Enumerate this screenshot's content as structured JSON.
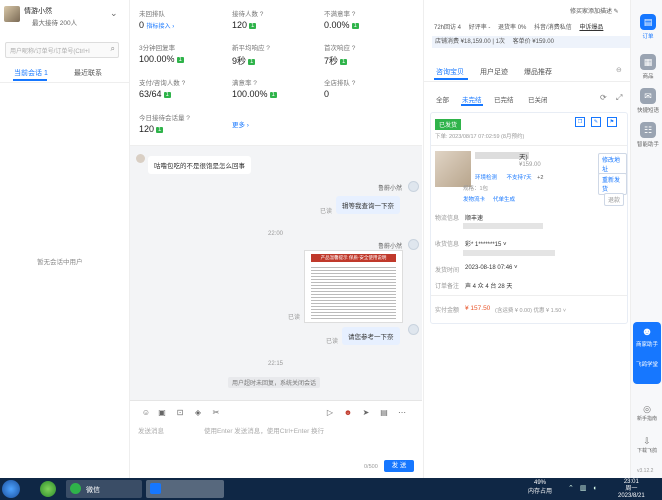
{
  "left": {
    "shop_name": "情游小然",
    "shop_sub": "最大接待 200人",
    "search_placeholder": "用户昵称/订单号/订单号(Ctrl+I",
    "tabs": [
      "当前会话 1",
      "最近联系"
    ],
    "empty_text": "暂无会话中用户"
  },
  "stats": [
    {
      "label": "未回排队",
      "value": "0",
      "extra": "指标接入 ›",
      "badge": ""
    },
    {
      "label": "接待人数 ?",
      "value": "120",
      "extra": "",
      "badge": "1"
    },
    {
      "label": "不满意率 ?",
      "value": "0.00%",
      "extra": "",
      "badge": "1"
    },
    {
      "label": "3分钟回复率",
      "value": "100.00%",
      "extra": "",
      "badge": "1"
    },
    {
      "label": "新平均响应 ?",
      "value": "9秒",
      "extra": "",
      "badge": "1"
    },
    {
      "label": "首次响应 ?",
      "value": "7秒",
      "extra": "",
      "badge": "1"
    },
    {
      "label": "支付/咨询人数 ?",
      "value": "63/64",
      "extra": "",
      "badge": "1"
    },
    {
      "label": "满意率 ?",
      "value": "100.00%",
      "extra": "",
      "badge": "1"
    },
    {
      "label": "全店排队 ?",
      "value": "0",
      "extra": "",
      "badge": ""
    },
    {
      "label": "今日接待会话量 ?",
      "value": "120",
      "extra": "",
      "badge": "1"
    },
    {
      "label": "",
      "value": "",
      "extra": "更多 ›",
      "badge": ""
    }
  ],
  "chat": {
    "m1": "咕噜包吃的不是很饱是怎么回事",
    "agent_name": "鲁蔚小然",
    "read": "已读",
    "m2": "辑等我查询一下奈",
    "time1": "22:00",
    "m3": "请您参考一下奈",
    "time2": "22:15",
    "sys": "用户超时未回复，系统关闭会话",
    "img_title": "产品温馨提示 保质·安全使用说明",
    "input_placeholder": "发送消息",
    "input_hint": "使用Enter 发送消息，使用Ctrl+Enter 换行",
    "send": "发 送",
    "count": "0/500"
  },
  "right": {
    "notice_top": "修买家添加描述 ✎",
    "r72": "72h回访 4",
    "good_rate": "好评率 -",
    "return_rate": "退货率 0%",
    "complaint": "抖音/消费私信",
    "check": "申诉爆品",
    "shop_consumed": "店铺消费 ¥18,159.00 | 1次",
    "single": "客单价 ¥159.00",
    "tabs": [
      "咨询宝贝",
      "用户足迹",
      "爆品推荐"
    ],
    "filter_tabs": [
      "全部",
      "未完结",
      "已完结",
      "已关闭"
    ],
    "order_status": "已发货",
    "order_time": "下单: 2023/08/17 07:02:59 (8月预约)",
    "product_name": "天)",
    "product_price": "¥159.00",
    "product_tag1": "环境检测",
    "product_tag2": "不支持7天",
    "product_tag3": "+2",
    "product_spec": "规格：1包",
    "btn_modify": "修改地址",
    "btn_change": "重新发货",
    "btn_refund": "退款",
    "btn_track": "发物流卡",
    "btn_generate": "代单生成",
    "logistics_label": "物流信息",
    "logistics_val": "顺丰速",
    "receiver_label": "收货信息",
    "receiver_val": "彩* 1*******15 ˅",
    "shipped_label": "发货时间",
    "shipped_val": "2023-08-18 07:46 ˅",
    "remark_label": "订单备注",
    "remark_val": "声 4 众 4 台 28 天",
    "paid_label": "实付金额",
    "paid_val": "¥ 157.50",
    "paid_sub": "(含运费 ¥ 0.00)  优惠 ¥ 1.50 ˅"
  },
  "sidebar": {
    "items": [
      "订单",
      "商品",
      "快捷短语",
      "智能助手"
    ],
    "helper1": "商家助手",
    "helper2": "飞鸽学堂",
    "ver": "v3.12.2",
    "bottom1": "新手指南",
    "bottom2": "下载飞鸽"
  },
  "taskbar": {
    "app": "微信",
    "battery": "49%",
    "battery_sub": "内存占用",
    "time": "23:01",
    "weekday": "周一",
    "date": "2023/8/21"
  },
  "colors": {
    "accent": "#1677ff",
    "green": "#2fb34a",
    "taskbar": "#0f2745"
  }
}
